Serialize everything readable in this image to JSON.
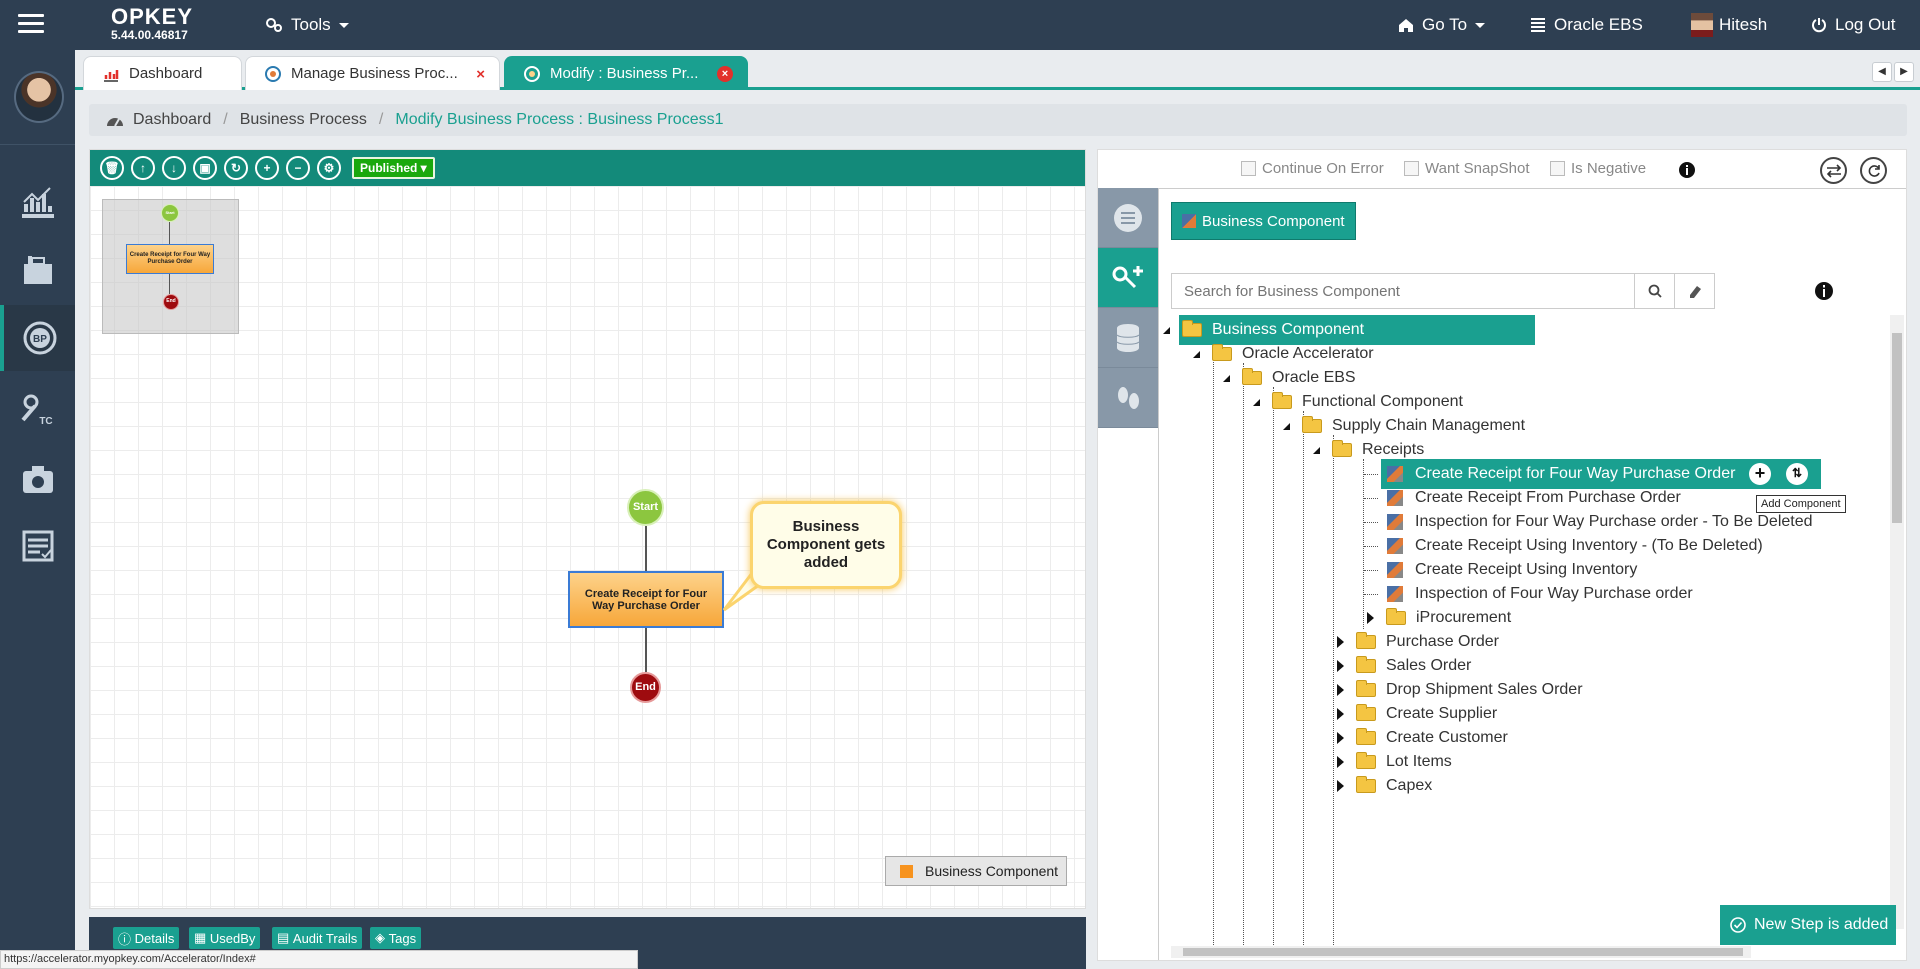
{
  "app": {
    "brand": "OPKEY",
    "version": "5.44.00.46817"
  },
  "topbar": {
    "tools_label": "Tools",
    "goto_label": "Go To",
    "project_label": "Oracle EBS",
    "user_label": "Hitesh",
    "logout_label": "Log Out"
  },
  "tabs": [
    {
      "label": "Dashboard",
      "icon": "chart-icon"
    },
    {
      "label": "Manage Business Proc...",
      "icon": "process-icon",
      "close": "×"
    },
    {
      "label": "Modify : Business Pr...",
      "icon": "process-icon",
      "close": "×"
    }
  ],
  "breadcrumb": {
    "home": "Dashboard",
    "parent": "Business Process",
    "current": "Modify Business Process : Business Process1"
  },
  "canvas": {
    "status_select": "Published",
    "minimap": {
      "start": "Start",
      "task": "Create Receipt for Four Way Purchase Order",
      "end": "End"
    },
    "start_label": "Start",
    "task_label": "Create Receipt for Four Way Purchase Order",
    "end_label": "End",
    "callout": "Business Component gets added",
    "legend_label": "Business Component"
  },
  "bottom_tabs": [
    "Details",
    "UsedBy",
    "Audit Trails",
    "Tags"
  ],
  "status_url": "https://accelerator.myopkey.com/Accelerator/Index#",
  "right_panel": {
    "options": [
      "Continue On Error",
      "Want SnapShot",
      "Is Negative"
    ],
    "bc_button": "Business Component",
    "search_placeholder": "Search for Business Component",
    "tooltip": "Add Component",
    "tree": [
      {
        "label": "Business Component",
        "type": "folder",
        "level": 0,
        "state": "open",
        "selected": true
      },
      {
        "label": "Oracle Accelerator",
        "type": "folder",
        "level": 1,
        "state": "open"
      },
      {
        "label": "Oracle EBS",
        "type": "folder",
        "level": 2,
        "state": "open"
      },
      {
        "label": "Functional Component",
        "type": "folder",
        "level": 3,
        "state": "open"
      },
      {
        "label": "Supply Chain Management",
        "type": "folder",
        "level": 4,
        "state": "open"
      },
      {
        "label": "Receipts",
        "type": "folder",
        "level": 5,
        "state": "open"
      },
      {
        "label": "Create Receipt for Four Way Purchase Order",
        "type": "component",
        "level": 6,
        "selected": true
      },
      {
        "label": "Create Receipt From Purchase Order",
        "type": "component",
        "level": 6
      },
      {
        "label": "Inspection for Four Way Purchase order - To Be Deleted",
        "type": "component",
        "level": 6
      },
      {
        "label": "Create Receipt Using Inventory - (To Be Deleted)",
        "type": "component",
        "level": 6
      },
      {
        "label": "Create Receipt Using Inventory",
        "type": "component",
        "level": 6
      },
      {
        "label": "Inspection of Four Way Purchase order",
        "type": "component",
        "level": 6
      },
      {
        "label": "iProcurement",
        "type": "folder",
        "level": 6,
        "state": "closed"
      },
      {
        "label": "Purchase Order",
        "type": "folder",
        "level": 5,
        "state": "closed"
      },
      {
        "label": "Sales Order",
        "type": "folder",
        "level": 5,
        "state": "closed"
      },
      {
        "label": "Drop Shipment Sales Order",
        "type": "folder",
        "level": 5,
        "state": "closed"
      },
      {
        "label": "Create Supplier",
        "type": "folder",
        "level": 5,
        "state": "closed"
      },
      {
        "label": "Create Customer",
        "type": "folder",
        "level": 5,
        "state": "closed"
      },
      {
        "label": "Lot Items",
        "type": "folder",
        "level": 5,
        "state": "closed"
      },
      {
        "label": "Capex",
        "type": "folder",
        "level": 5,
        "state": "closed"
      }
    ]
  },
  "toast": "New Step is added"
}
